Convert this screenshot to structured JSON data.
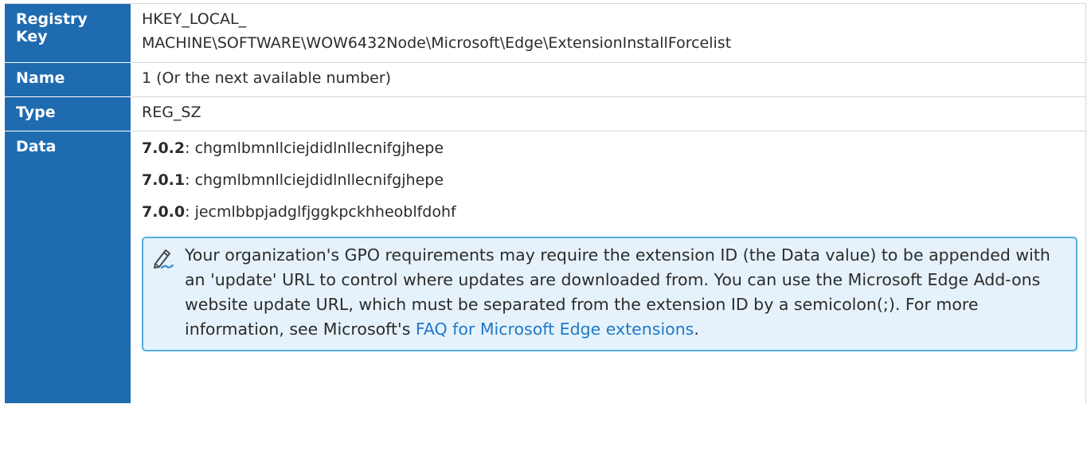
{
  "rows": {
    "registry_key": {
      "label": "Registry Key",
      "value_line1": "HKEY_LOCAL_",
      "value_line2": "MACHINE\\SOFTWARE\\WOW6432Node\\Microsoft\\Edge\\ExtensionInstallForcelist"
    },
    "name": {
      "label": "Name",
      "value": "1 (Or the next available number)"
    },
    "type": {
      "label": "Type",
      "value": "REG_SZ"
    },
    "data": {
      "label": "Data",
      "entries": [
        {
          "version": "7.0.2",
          "separator": ": ",
          "id": "chgmlbmnllciejdidlnllecnifgjhepe"
        },
        {
          "version": "7.0.1",
          "separator": ": ",
          "id": "chgmlbmnllciejdidlnllecnifgjhepe"
        },
        {
          "version": "7.0.0",
          "separator": ": ",
          "id": "jecmlbbpjadglfjggkpckhheoblfdohf"
        }
      ]
    }
  },
  "note": {
    "icon": "pencil-note-icon",
    "text": "Your organization's GPO requirements may require the extension ID (the Data value) to be appended with an 'update' URL to control where updates are downloaded from. You can use the Microsoft Edge Add-ons website update URL, which must be separated from the extension ID by a semicolon(;). For more information, see Microsoft's ",
    "link_text": "FAQ for Microsoft Edge extensions",
    "trailing": "."
  },
  "colors": {
    "header_blue": "#1f6bb0",
    "note_bg": "#e6f2fb",
    "note_border": "#54aee0",
    "link": "#1f78c8"
  }
}
